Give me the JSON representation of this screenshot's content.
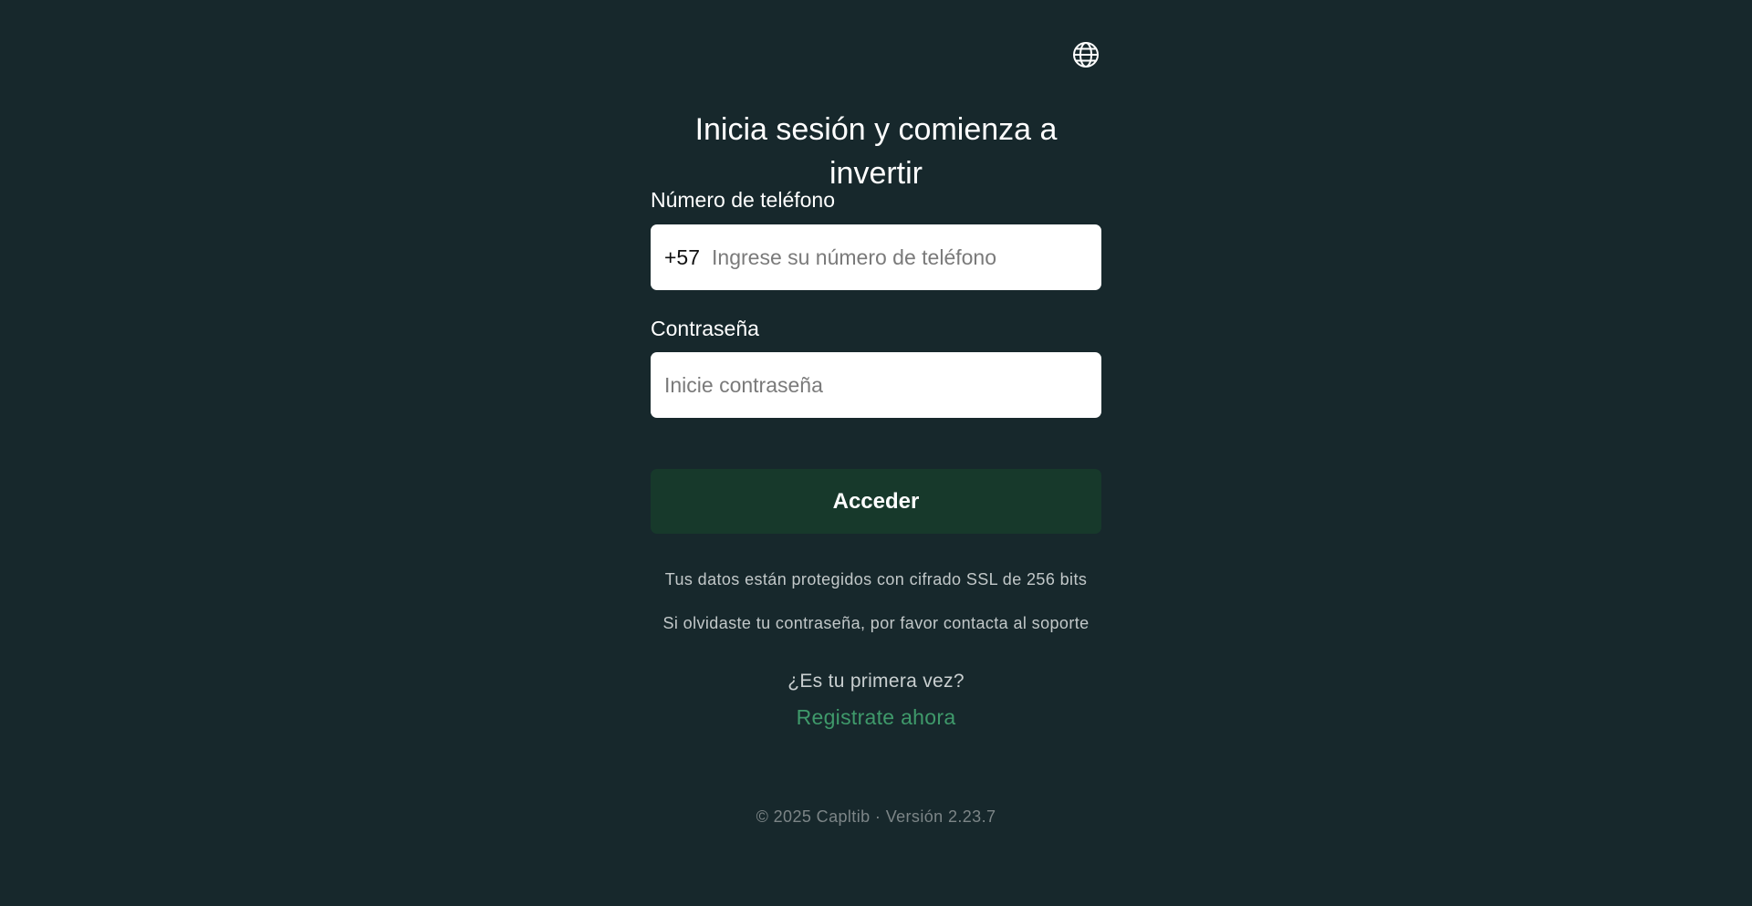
{
  "header": {
    "language_icon": "globe-icon"
  },
  "login": {
    "title": "Inicia sesión y comienza a invertir",
    "phone_label": "Número de teléfono",
    "phone_prefix": "+57",
    "phone_placeholder": "Ingrese su número de teléfono",
    "phone_value": "",
    "password_label": "Contraseña",
    "password_placeholder": "Inicie contraseña",
    "password_value": "",
    "submit_label": "Acceder",
    "ssl_note": "Tus datos están protegidos con cifrado SSL de 256 bits",
    "forgot_note": "Si olvidaste tu contraseña, por favor contacta al soporte",
    "first_time_text": "¿Es tu primera vez?",
    "register_link": "Registrate ahora"
  },
  "footer": {
    "text": "© 2025 Capltib · Versión 2.23.7"
  },
  "colors": {
    "background": "#17282c",
    "button": "#17392b",
    "link": "#3f9a6b",
    "field": "#ffffff"
  }
}
